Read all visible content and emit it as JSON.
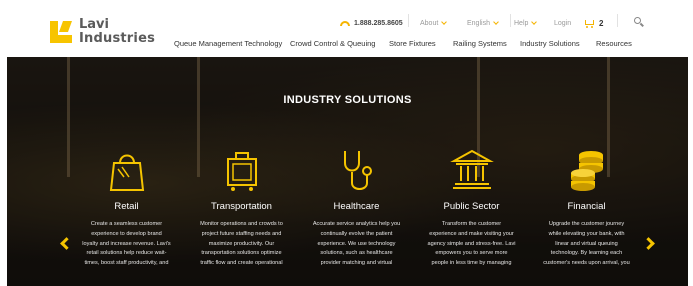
{
  "brand": {
    "line1": "Lavi",
    "line2": "Industries",
    "accent_color": "#f7c400"
  },
  "utility": {
    "phone": "1.888.285.8605",
    "about": "About",
    "language": "English",
    "help": "Help",
    "login": "Login",
    "cart_count": "2"
  },
  "nav": [
    {
      "label": "Queue Management Technology"
    },
    {
      "label": "Crowd Control & Queuing"
    },
    {
      "label": "Store Fixtures"
    },
    {
      "label": "Railing Systems"
    },
    {
      "label": "Industry Solutions"
    },
    {
      "label": "Resources"
    }
  ],
  "hero": {
    "title": "INDUSTRY SOLUTIONS",
    "categories": [
      {
        "icon": "shopping-bag-icon",
        "title": "Retail",
        "lines": [
          "Create a seamless customer",
          "experience to develop brand",
          "loyalty and increase revenue. Lavi's",
          "retail solutions help reduce wait-",
          "times, boost staff productivity, and"
        ]
      },
      {
        "icon": "luggage-icon",
        "title": "Transportation",
        "lines": [
          "Monitor operations and crowds to",
          "project future staffing needs and",
          "maximize productivity. Our",
          "transportation solutions optimize",
          "traffic flow and create operational"
        ]
      },
      {
        "icon": "stethoscope-icon",
        "title": "Healthcare",
        "lines": [
          "Accurate service analytics help you",
          "continually evolve the patient",
          "experience. We use technology",
          "solutions, such as healthcare",
          "provider matching and virtual"
        ]
      },
      {
        "icon": "government-building-icon",
        "title": "Public Sector",
        "lines": [
          "Transform the customer",
          "experience and make visiting your",
          "agency simple and stress-free. Lavi",
          "empowers you to serve more",
          "people in less time by managing"
        ]
      },
      {
        "icon": "coin-stack-icon",
        "title": "Financial",
        "lines": [
          "Upgrade the customer journey",
          "while elevating your bank, with",
          "linear and virtual queuing",
          "technology. By learning each",
          "customer's needs upon arrival, you"
        ]
      }
    ]
  }
}
